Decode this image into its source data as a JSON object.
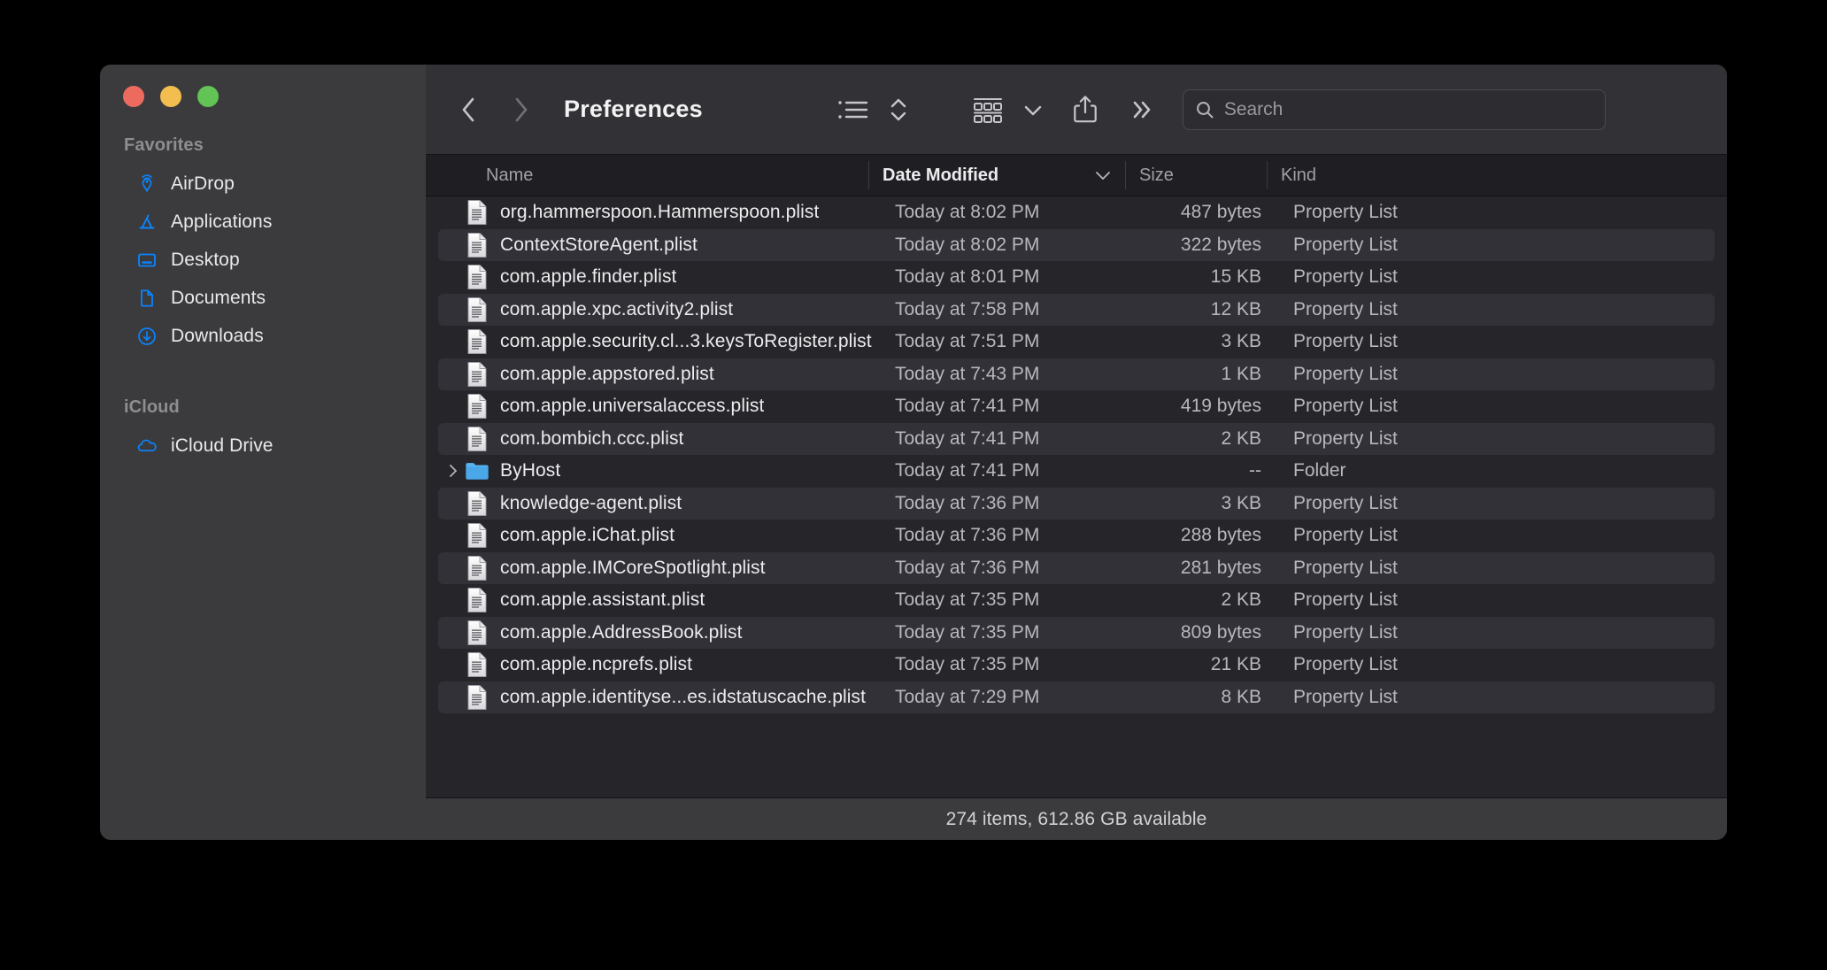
{
  "window": {
    "title": "Preferences",
    "traffic_lights": [
      {
        "name": "close",
        "color": "#ed6a5f"
      },
      {
        "name": "minimize",
        "color": "#f4bd4f"
      },
      {
        "name": "zoom",
        "color": "#61c454"
      }
    ]
  },
  "sidebar": {
    "sections": [
      {
        "header": "Favorites",
        "items": [
          {
            "label": "AirDrop",
            "icon": "airdrop-icon"
          },
          {
            "label": "Applications",
            "icon": "applications-icon"
          },
          {
            "label": "Desktop",
            "icon": "desktop-icon"
          },
          {
            "label": "Documents",
            "icon": "documents-icon"
          },
          {
            "label": "Downloads",
            "icon": "downloads-icon"
          }
        ]
      },
      {
        "header": "iCloud",
        "items": [
          {
            "label": "iCloud Drive",
            "icon": "icloud-icon"
          }
        ]
      }
    ],
    "accent_color": "#0a84ff"
  },
  "toolbar": {
    "back_label": "Back",
    "forward_label": "Forward",
    "view_list_label": "List View",
    "sort_label": "Sort",
    "group_label": "Group",
    "share_label": "Share",
    "more_label": "More",
    "search": {
      "placeholder": "Search",
      "value": ""
    }
  },
  "columns": [
    {
      "key": "name",
      "label": "Name",
      "active": false,
      "sort": null
    },
    {
      "key": "date",
      "label": "Date Modified",
      "active": true,
      "sort": "desc"
    },
    {
      "key": "size",
      "label": "Size",
      "active": false,
      "sort": null
    },
    {
      "key": "kind",
      "label": "Kind",
      "active": false,
      "sort": null
    }
  ],
  "files": [
    {
      "name": "org.hammerspoon.Hammerspoon.plist",
      "date": "Today at 8:02 PM",
      "size": "487 bytes",
      "kind": "Property List",
      "icon": "plist-file-icon",
      "expandable": false
    },
    {
      "name": "ContextStoreAgent.plist",
      "date": "Today at 8:02 PM",
      "size": "322 bytes",
      "kind": "Property List",
      "icon": "plist-file-icon",
      "expandable": false
    },
    {
      "name": "com.apple.finder.plist",
      "date": "Today at 8:01 PM",
      "size": "15 KB",
      "kind": "Property List",
      "icon": "plist-file-icon",
      "expandable": false
    },
    {
      "name": "com.apple.xpc.activity2.plist",
      "date": "Today at 7:58 PM",
      "size": "12 KB",
      "kind": "Property List",
      "icon": "plist-file-icon",
      "expandable": false
    },
    {
      "name": "com.apple.security.cl...3.keysToRegister.plist",
      "date": "Today at 7:51 PM",
      "size": "3 KB",
      "kind": "Property List",
      "icon": "plist-file-icon",
      "expandable": false
    },
    {
      "name": "com.apple.appstored.plist",
      "date": "Today at 7:43 PM",
      "size": "1 KB",
      "kind": "Property List",
      "icon": "plist-file-icon",
      "expandable": false
    },
    {
      "name": "com.apple.universalaccess.plist",
      "date": "Today at 7:41 PM",
      "size": "419 bytes",
      "kind": "Property List",
      "icon": "plist-file-icon",
      "expandable": false
    },
    {
      "name": "com.bombich.ccc.plist",
      "date": "Today at 7:41 PM",
      "size": "2 KB",
      "kind": "Property List",
      "icon": "plist-file-icon",
      "expandable": false
    },
    {
      "name": "ByHost",
      "date": "Today at 7:41 PM",
      "size": "--",
      "kind": "Folder",
      "icon": "folder-icon",
      "expandable": true
    },
    {
      "name": "knowledge-agent.plist",
      "date": "Today at 7:36 PM",
      "size": "3 KB",
      "kind": "Property List",
      "icon": "plist-file-icon",
      "expandable": false
    },
    {
      "name": "com.apple.iChat.plist",
      "date": "Today at 7:36 PM",
      "size": "288 bytes",
      "kind": "Property List",
      "icon": "plist-file-icon",
      "expandable": false
    },
    {
      "name": "com.apple.IMCoreSpotlight.plist",
      "date": "Today at 7:36 PM",
      "size": "281 bytes",
      "kind": "Property List",
      "icon": "plist-file-icon",
      "expandable": false
    },
    {
      "name": "com.apple.assistant.plist",
      "date": "Today at 7:35 PM",
      "size": "2 KB",
      "kind": "Property List",
      "icon": "plist-file-icon",
      "expandable": false
    },
    {
      "name": "com.apple.AddressBook.plist",
      "date": "Today at 7:35 PM",
      "size": "809 bytes",
      "kind": "Property List",
      "icon": "plist-file-icon",
      "expandable": false
    },
    {
      "name": "com.apple.ncprefs.plist",
      "date": "Today at 7:35 PM",
      "size": "21 KB",
      "kind": "Property List",
      "icon": "plist-file-icon",
      "expandable": false
    },
    {
      "name": "com.apple.identityse...es.idstatuscache.plist",
      "date": "Today at 7:29 PM",
      "size": "8 KB",
      "kind": "Property List",
      "icon": "plist-file-icon",
      "expandable": false
    }
  ],
  "status": {
    "text": "274 items, 612.86 GB available"
  }
}
